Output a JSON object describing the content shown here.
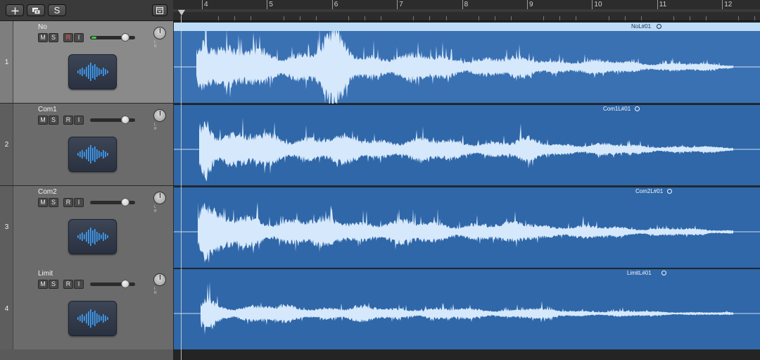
{
  "toolbar": {
    "add_button_icon": "plus-icon",
    "duplicate_button_icon": "duplicate-track-icon",
    "s_button_label": "S",
    "options_button_icon": "track-options-icon"
  },
  "ruler": {
    "bars": [
      "4",
      "5",
      "6",
      "7",
      "8",
      "9",
      "10",
      "11",
      "12"
    ]
  },
  "button_labels": {
    "mute": "M",
    "solo": "S",
    "record": "R",
    "input": "I"
  },
  "pan_labels": "L R",
  "colors": {
    "region_fill": "#2f67a8",
    "waveform": "#d6e8fb",
    "selected_label_bar": "#bfdcf6",
    "meter_green": "#39d339",
    "record_red": "#ff5a4f"
  },
  "tracks": [
    {
      "number": "1",
      "name": "No",
      "region_label": "NoL#01",
      "selected": true,
      "record_armed": true,
      "volume_level": 0.88,
      "meter_level": 0.12,
      "icon": "audio-waveform-icon"
    },
    {
      "number": "2",
      "name": "Com1",
      "region_label": "Com1L#01",
      "selected": false,
      "record_armed": false,
      "volume_level": 0.88,
      "meter_level": 0,
      "icon": "audio-waveform-icon"
    },
    {
      "number": "3",
      "name": "Com2",
      "region_label": "Com2L#01",
      "selected": false,
      "record_armed": false,
      "volume_level": 0.88,
      "meter_level": 0,
      "icon": "audio-waveform-icon"
    },
    {
      "number": "4",
      "name": "Limit",
      "region_label": "LimitL#01",
      "selected": false,
      "record_armed": false,
      "volume_level": 0.88,
      "meter_level": 0,
      "icon": "audio-waveform-icon"
    }
  ]
}
